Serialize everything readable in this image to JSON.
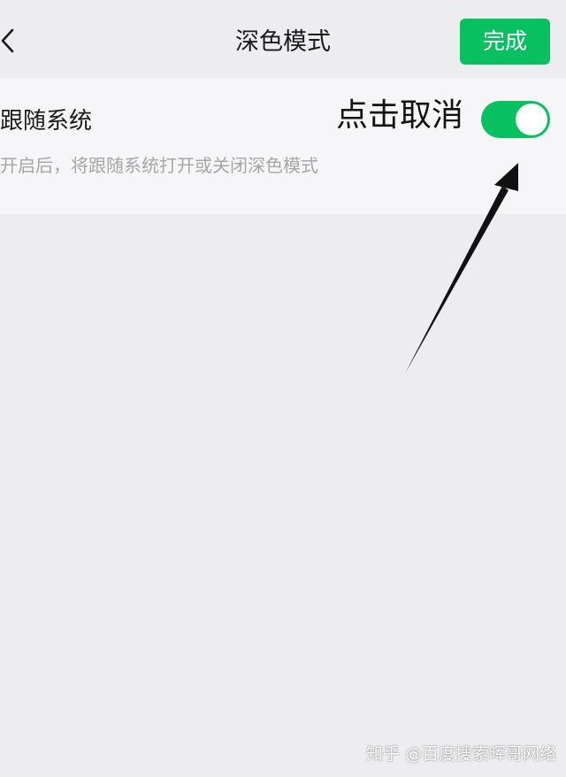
{
  "header": {
    "title": "深色模式",
    "done_label": "完成"
  },
  "setting": {
    "label": "跟随系统",
    "description": "开启后，将跟随系统打开或关闭深色模式",
    "toggle_on": true
  },
  "annotation": {
    "text": "点击取消"
  },
  "watermark": {
    "text": "知乎 @百度搜索晖哥网络"
  },
  "colors": {
    "accent": "#07c160",
    "background": "#ededf0",
    "card": "#f6f6f8"
  }
}
